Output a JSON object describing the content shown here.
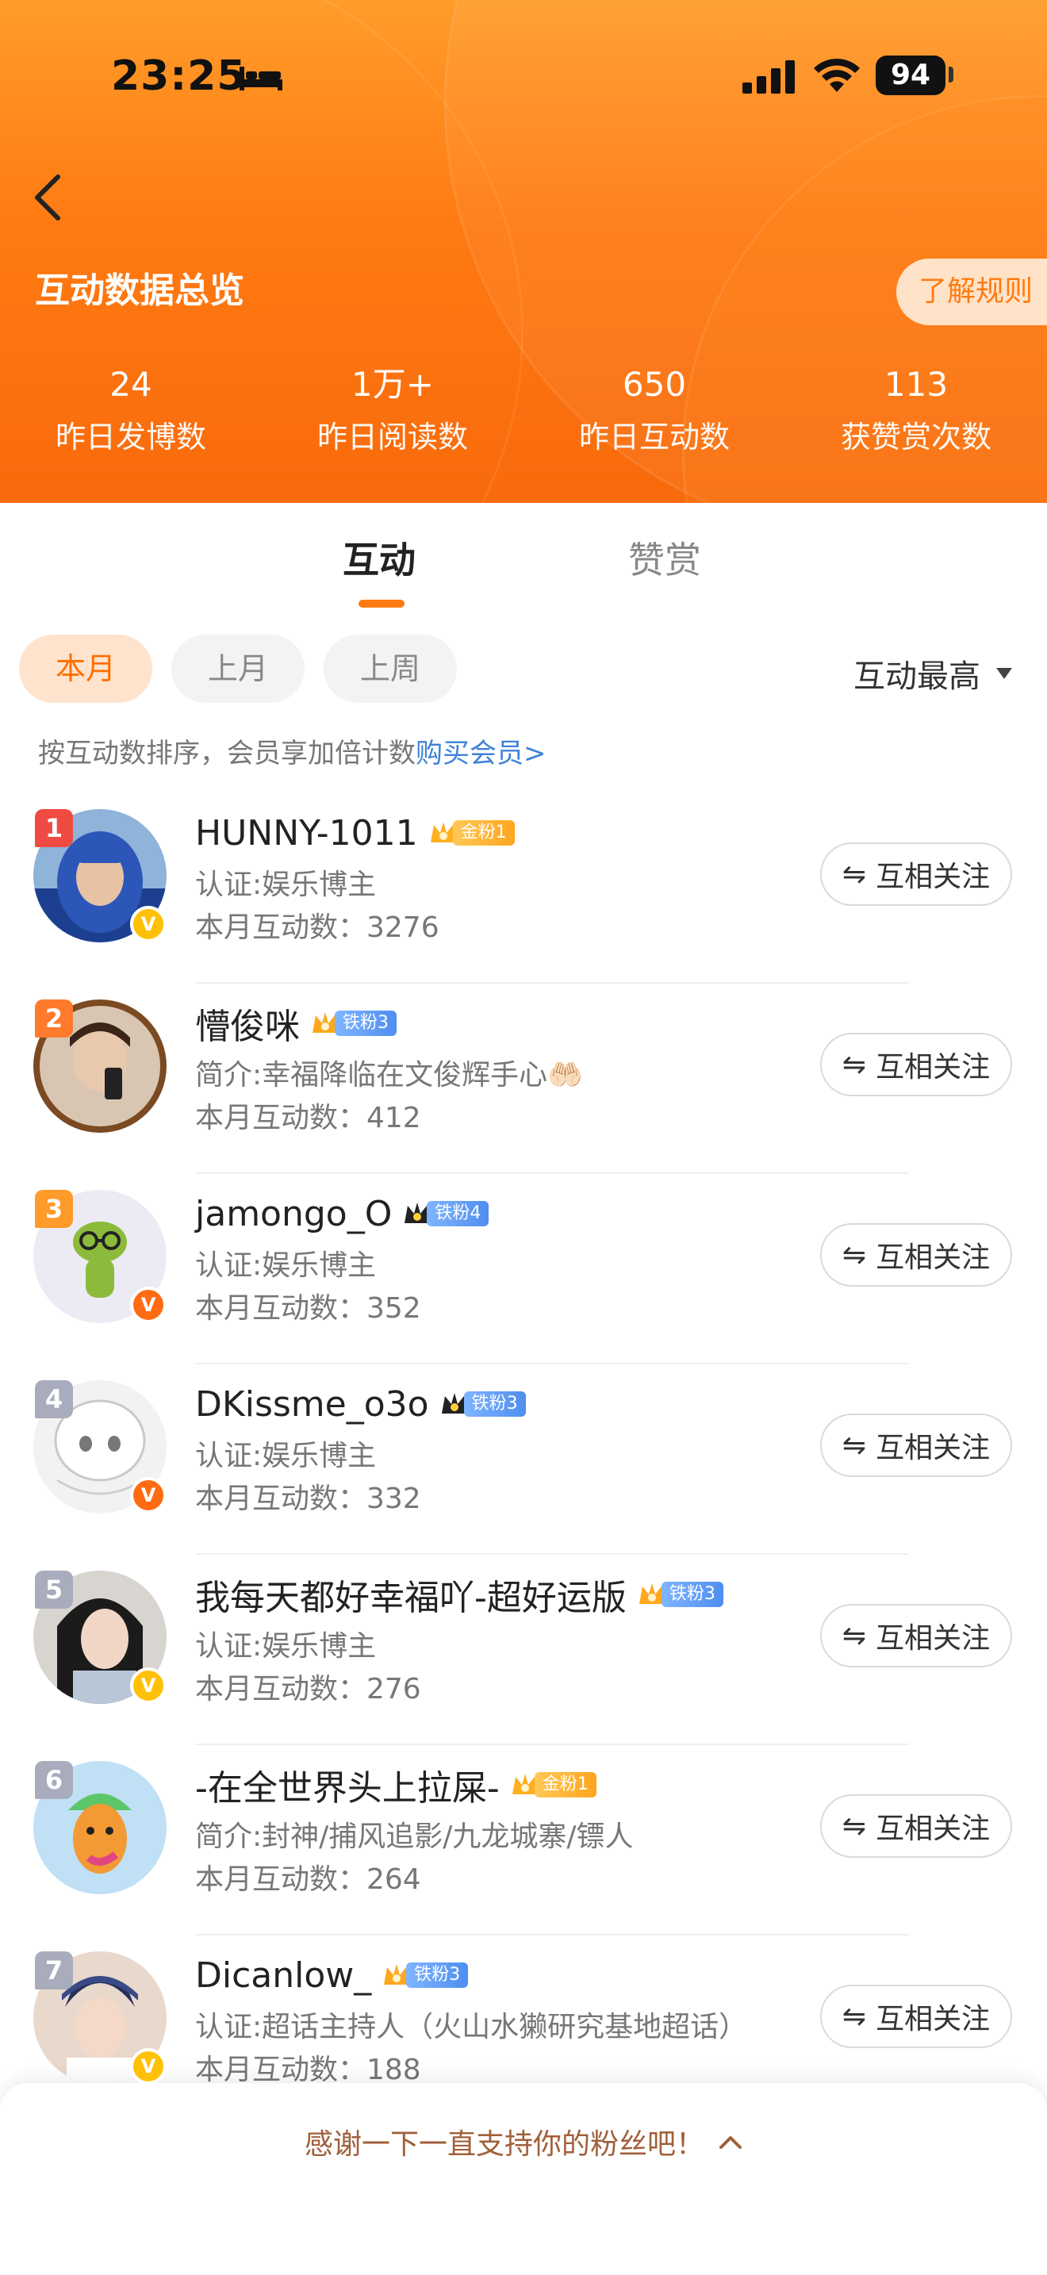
{
  "status_bar": {
    "time": "23:25",
    "battery": "94",
    "icons": [
      "bed-icon",
      "signal-icon",
      "wifi-icon"
    ]
  },
  "header": {
    "title": "互动数据总览",
    "rules_label": "了解规则",
    "stats": [
      {
        "value": "24",
        "label": "昨日发博数"
      },
      {
        "value": "1万+",
        "label": "昨日阅读数"
      },
      {
        "value": "650",
        "label": "昨日互动数"
      },
      {
        "value": "113",
        "label": "获赞赏次数"
      }
    ]
  },
  "tabs": [
    {
      "label": "互动",
      "active": true
    },
    {
      "label": "赞赏",
      "active": false
    }
  ],
  "filters": {
    "chips": [
      "本月",
      "上月",
      "上周"
    ],
    "active": "本月",
    "sort_label": "互动最高"
  },
  "hint": {
    "text": "按互动数排序，会员享加倍计数",
    "link": "购买会员>"
  },
  "colors": {
    "accent": "#ff7a12",
    "link": "#3f82d8",
    "gold_badge": "#ffb020",
    "iron_badge": "#5c97f2"
  },
  "list": [
    {
      "rank": "1",
      "name": "HUNNY-1011",
      "badge": "金粉1",
      "badge_type": "gold",
      "bio": "认证:娱乐博主",
      "count": "本月互动数：3276",
      "verified": "gold",
      "follow_label": "互相关注"
    },
    {
      "rank": "2",
      "name": "懵俊咪",
      "badge": "铁粉3",
      "badge_type": "iron",
      "bio": "简介:幸福降临在文俊辉手心🤲🏻",
      "count": "本月互动数：412",
      "verified": "",
      "follow_label": "互相关注"
    },
    {
      "rank": "3",
      "name": "jamongo_O",
      "badge": "铁粉4",
      "badge_type": "iron",
      "bio": "认证:娱乐博主",
      "count": "本月互动数：352",
      "verified": "orange",
      "follow_label": "互相关注"
    },
    {
      "rank": "4",
      "name": "DKissme_o3o",
      "badge": "铁粉3",
      "badge_type": "iron",
      "bio": "认证:娱乐博主",
      "count": "本月互动数：332",
      "verified": "orange",
      "follow_label": "互相关注"
    },
    {
      "rank": "5",
      "name": "我每天都好幸福吖-超好运版",
      "badge": "铁粉3",
      "badge_type": "iron",
      "bio": "认证:娱乐博主",
      "count": "本月互动数：276",
      "verified": "gold",
      "follow_label": "互相关注"
    },
    {
      "rank": "6",
      "name": "-在全世界头上拉屎-",
      "badge": "金粉1",
      "badge_type": "gold",
      "bio": "简介:封神/捕风追影/九龙城寨/镖人",
      "count": "本月互动数：264",
      "verified": "",
      "follow_label": "互相关注"
    },
    {
      "rank": "7",
      "name": "Dicanlow_",
      "badge": "铁粉3",
      "badge_type": "iron",
      "bio": "认证:超话主持人（火山水獭研究基地超话）",
      "count": "本月互动数：188",
      "verified": "gold",
      "follow_label": "互相关注"
    }
  ],
  "bottom_sheet": {
    "text": "感谢一下一直支持你的粉丝吧！"
  }
}
